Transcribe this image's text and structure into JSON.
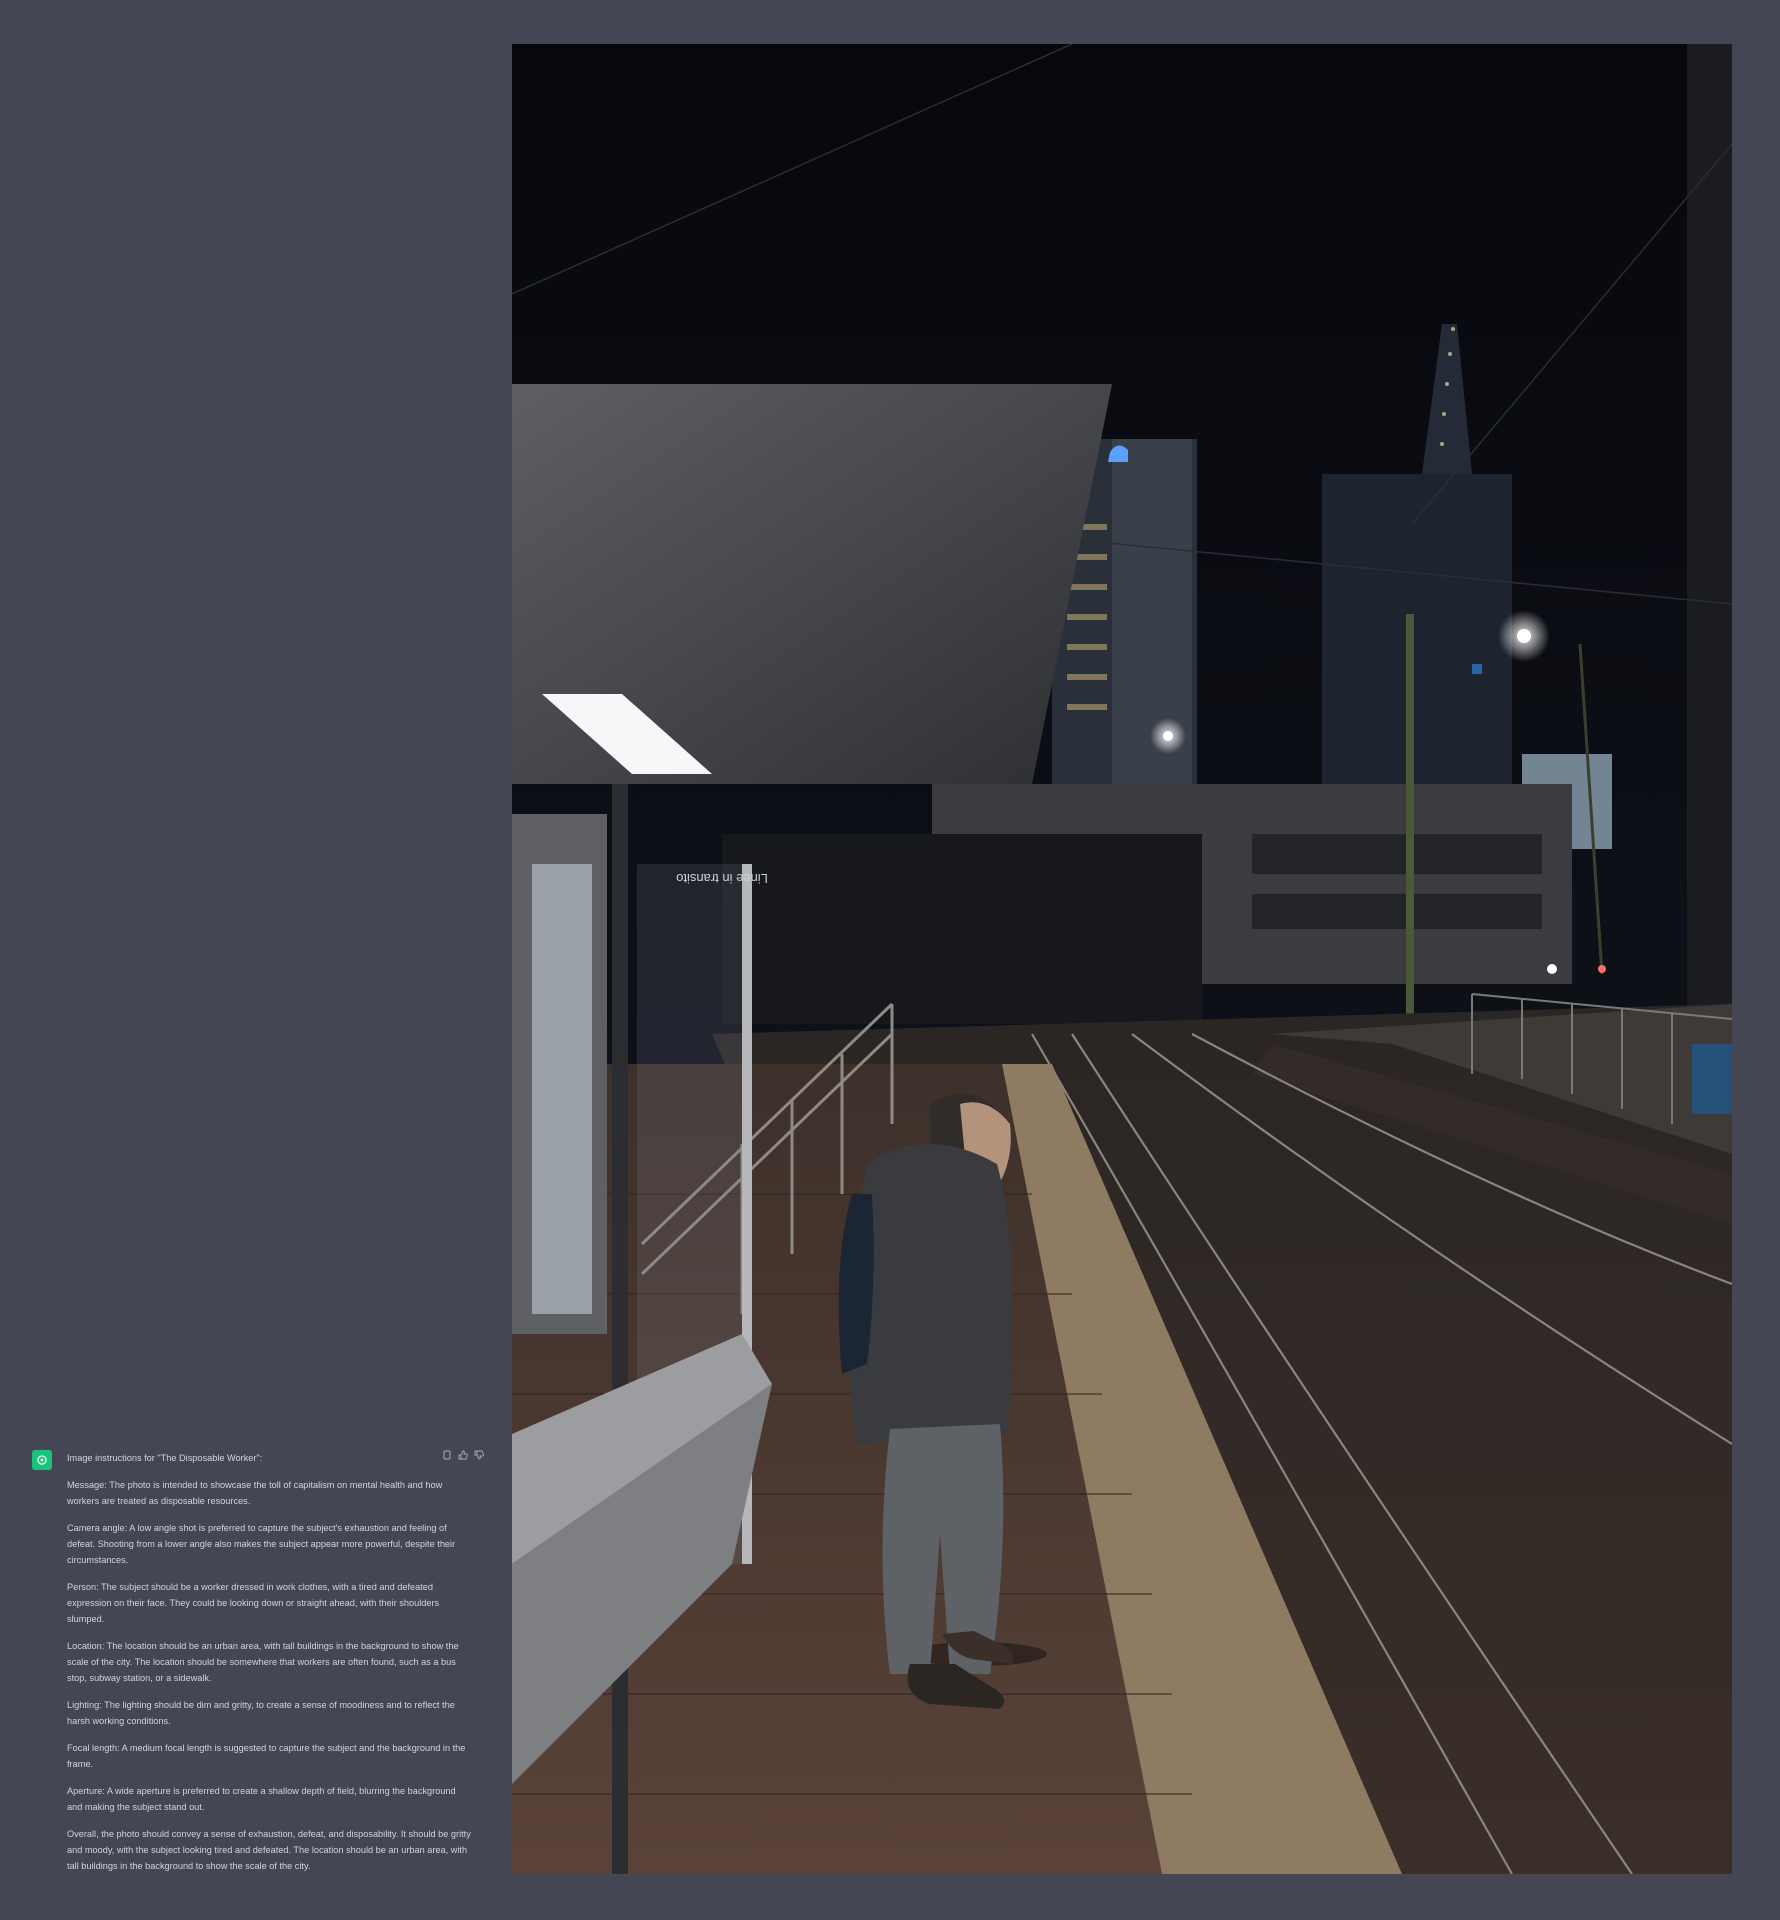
{
  "conversation": {
    "assistant_avatar_icon": "openai-logo-icon",
    "accent_color": "#19c37d",
    "actions": [
      "copy-icon",
      "thumbs-up-icon",
      "thumbs-down-icon"
    ],
    "intro": "Image instructions for \"The Disposable Worker\":",
    "paragraphs": [
      "Message: The photo is intended to showcase the toll of capitalism on mental health and how workers are treated as disposable resources.",
      "Camera angle: A low angle shot is preferred to capture the subject's exhaustion and feeling of defeat. Shooting from a lower angle also makes the subject appear more powerful, despite their circumstances.",
      "Person: The subject should be a worker dressed in work clothes, with a tired and defeated expression on their face. They could be looking down or straight ahead, with their shoulders slumped.",
      "Location: The location should be an urban area, with tall buildings in the background to show the scale of the city. The location should be somewhere that workers are often found, such as a bus stop, subway station, or a sidewalk.",
      "Lighting: The lighting should be dim and gritty, to create a sense of moodiness and to reflect the harsh working conditions.",
      "Focal length: A medium focal length is suggested to capture the subject and the background in the frame.",
      "Aperture: A wide aperture is preferred to create a shallow depth of field, blurring the background and making the subject stand out.",
      "Overall, the photo should convey a sense of exhaustion, defeat, and disposability. It should be gritty and moody, with the subject looking tired and defeated. The location should be an urban area, with tall buildings in the background to show the scale of the city."
    ]
  },
  "photo": {
    "shelter_sign": "Linee in transito"
  }
}
